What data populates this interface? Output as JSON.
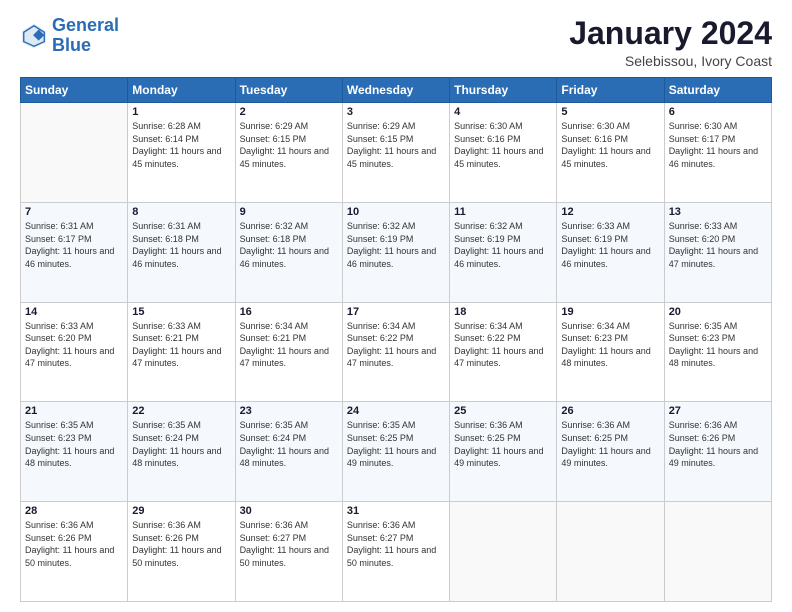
{
  "logo": {
    "line1": "General",
    "line2": "Blue"
  },
  "title": "January 2024",
  "subtitle": "Selebissou, Ivory Coast",
  "days_header": [
    "Sunday",
    "Monday",
    "Tuesday",
    "Wednesday",
    "Thursday",
    "Friday",
    "Saturday"
  ],
  "weeks": [
    [
      {
        "num": "",
        "sunrise": "",
        "sunset": "",
        "daylight": ""
      },
      {
        "num": "1",
        "sunrise": "Sunrise: 6:28 AM",
        "sunset": "Sunset: 6:14 PM",
        "daylight": "Daylight: 11 hours and 45 minutes."
      },
      {
        "num": "2",
        "sunrise": "Sunrise: 6:29 AM",
        "sunset": "Sunset: 6:15 PM",
        "daylight": "Daylight: 11 hours and 45 minutes."
      },
      {
        "num": "3",
        "sunrise": "Sunrise: 6:29 AM",
        "sunset": "Sunset: 6:15 PM",
        "daylight": "Daylight: 11 hours and 45 minutes."
      },
      {
        "num": "4",
        "sunrise": "Sunrise: 6:30 AM",
        "sunset": "Sunset: 6:16 PM",
        "daylight": "Daylight: 11 hours and 45 minutes."
      },
      {
        "num": "5",
        "sunrise": "Sunrise: 6:30 AM",
        "sunset": "Sunset: 6:16 PM",
        "daylight": "Daylight: 11 hours and 45 minutes."
      },
      {
        "num": "6",
        "sunrise": "Sunrise: 6:30 AM",
        "sunset": "Sunset: 6:17 PM",
        "daylight": "Daylight: 11 hours and 46 minutes."
      }
    ],
    [
      {
        "num": "7",
        "sunrise": "Sunrise: 6:31 AM",
        "sunset": "Sunset: 6:17 PM",
        "daylight": "Daylight: 11 hours and 46 minutes."
      },
      {
        "num": "8",
        "sunrise": "Sunrise: 6:31 AM",
        "sunset": "Sunset: 6:18 PM",
        "daylight": "Daylight: 11 hours and 46 minutes."
      },
      {
        "num": "9",
        "sunrise": "Sunrise: 6:32 AM",
        "sunset": "Sunset: 6:18 PM",
        "daylight": "Daylight: 11 hours and 46 minutes."
      },
      {
        "num": "10",
        "sunrise": "Sunrise: 6:32 AM",
        "sunset": "Sunset: 6:19 PM",
        "daylight": "Daylight: 11 hours and 46 minutes."
      },
      {
        "num": "11",
        "sunrise": "Sunrise: 6:32 AM",
        "sunset": "Sunset: 6:19 PM",
        "daylight": "Daylight: 11 hours and 46 minutes."
      },
      {
        "num": "12",
        "sunrise": "Sunrise: 6:33 AM",
        "sunset": "Sunset: 6:19 PM",
        "daylight": "Daylight: 11 hours and 46 minutes."
      },
      {
        "num": "13",
        "sunrise": "Sunrise: 6:33 AM",
        "sunset": "Sunset: 6:20 PM",
        "daylight": "Daylight: 11 hours and 47 minutes."
      }
    ],
    [
      {
        "num": "14",
        "sunrise": "Sunrise: 6:33 AM",
        "sunset": "Sunset: 6:20 PM",
        "daylight": "Daylight: 11 hours and 47 minutes."
      },
      {
        "num": "15",
        "sunrise": "Sunrise: 6:33 AM",
        "sunset": "Sunset: 6:21 PM",
        "daylight": "Daylight: 11 hours and 47 minutes."
      },
      {
        "num": "16",
        "sunrise": "Sunrise: 6:34 AM",
        "sunset": "Sunset: 6:21 PM",
        "daylight": "Daylight: 11 hours and 47 minutes."
      },
      {
        "num": "17",
        "sunrise": "Sunrise: 6:34 AM",
        "sunset": "Sunset: 6:22 PM",
        "daylight": "Daylight: 11 hours and 47 minutes."
      },
      {
        "num": "18",
        "sunrise": "Sunrise: 6:34 AM",
        "sunset": "Sunset: 6:22 PM",
        "daylight": "Daylight: 11 hours and 47 minutes."
      },
      {
        "num": "19",
        "sunrise": "Sunrise: 6:34 AM",
        "sunset": "Sunset: 6:23 PM",
        "daylight": "Daylight: 11 hours and 48 minutes."
      },
      {
        "num": "20",
        "sunrise": "Sunrise: 6:35 AM",
        "sunset": "Sunset: 6:23 PM",
        "daylight": "Daylight: 11 hours and 48 minutes."
      }
    ],
    [
      {
        "num": "21",
        "sunrise": "Sunrise: 6:35 AM",
        "sunset": "Sunset: 6:23 PM",
        "daylight": "Daylight: 11 hours and 48 minutes."
      },
      {
        "num": "22",
        "sunrise": "Sunrise: 6:35 AM",
        "sunset": "Sunset: 6:24 PM",
        "daylight": "Daylight: 11 hours and 48 minutes."
      },
      {
        "num": "23",
        "sunrise": "Sunrise: 6:35 AM",
        "sunset": "Sunset: 6:24 PM",
        "daylight": "Daylight: 11 hours and 48 minutes."
      },
      {
        "num": "24",
        "sunrise": "Sunrise: 6:35 AM",
        "sunset": "Sunset: 6:25 PM",
        "daylight": "Daylight: 11 hours and 49 minutes."
      },
      {
        "num": "25",
        "sunrise": "Sunrise: 6:36 AM",
        "sunset": "Sunset: 6:25 PM",
        "daylight": "Daylight: 11 hours and 49 minutes."
      },
      {
        "num": "26",
        "sunrise": "Sunrise: 6:36 AM",
        "sunset": "Sunset: 6:25 PM",
        "daylight": "Daylight: 11 hours and 49 minutes."
      },
      {
        "num": "27",
        "sunrise": "Sunrise: 6:36 AM",
        "sunset": "Sunset: 6:26 PM",
        "daylight": "Daylight: 11 hours and 49 minutes."
      }
    ],
    [
      {
        "num": "28",
        "sunrise": "Sunrise: 6:36 AM",
        "sunset": "Sunset: 6:26 PM",
        "daylight": "Daylight: 11 hours and 50 minutes."
      },
      {
        "num": "29",
        "sunrise": "Sunrise: 6:36 AM",
        "sunset": "Sunset: 6:26 PM",
        "daylight": "Daylight: 11 hours and 50 minutes."
      },
      {
        "num": "30",
        "sunrise": "Sunrise: 6:36 AM",
        "sunset": "Sunset: 6:27 PM",
        "daylight": "Daylight: 11 hours and 50 minutes."
      },
      {
        "num": "31",
        "sunrise": "Sunrise: 6:36 AM",
        "sunset": "Sunset: 6:27 PM",
        "daylight": "Daylight: 11 hours and 50 minutes."
      },
      {
        "num": "",
        "sunrise": "",
        "sunset": "",
        "daylight": ""
      },
      {
        "num": "",
        "sunrise": "",
        "sunset": "",
        "daylight": ""
      },
      {
        "num": "",
        "sunrise": "",
        "sunset": "",
        "daylight": ""
      }
    ]
  ]
}
